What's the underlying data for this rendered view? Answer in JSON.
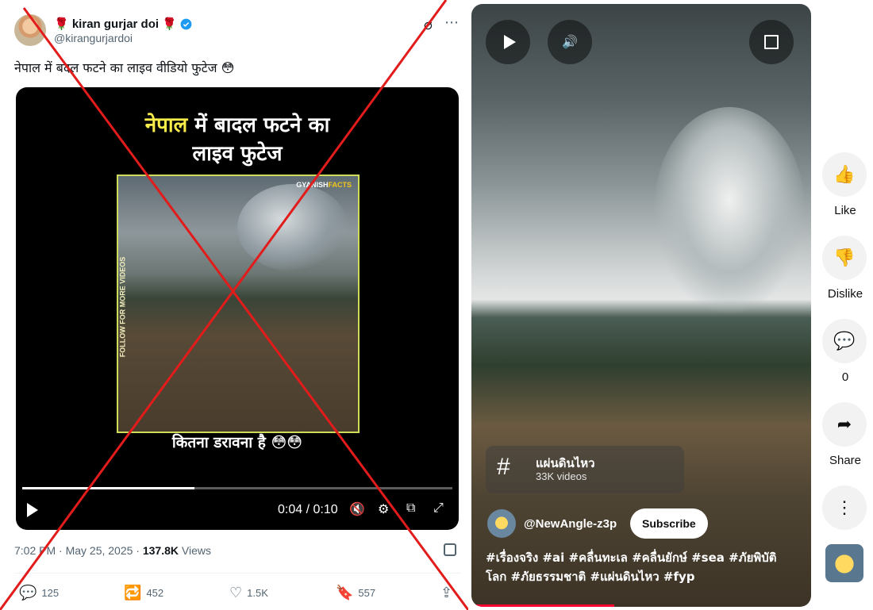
{
  "tweet": {
    "display_name": "🌹 kiran gurjar doi 🌹",
    "handle": "@kirangurjardoi",
    "text": "नेपाल में बदल फटने का लाइव वीडियो फुटेज 😳",
    "video": {
      "title_highlight": "नेपाल",
      "title_rest_line1": " में बादल फटने का",
      "title_line2": "लाइव फुटेज",
      "watermark_prefix": "GYANISH",
      "watermark_suffix": "FACTS",
      "side_text": "FOLLOW FOR MORE VIDEOS",
      "caption": "कितना डरावना है 😳😳",
      "time": "0:04 / 0:10",
      "progress": 0.4
    },
    "timestamp": "7:02 PM · May 25, 2025 · ",
    "views_count": "137.8K",
    "views_label": " Views",
    "actions": {
      "replies": "125",
      "reposts": "452",
      "likes": "1.5K",
      "bookmarks": "557"
    }
  },
  "short": {
    "tag_name": "แผ่นดินไหว",
    "tag_count": "33K videos",
    "channel": "@NewAngle-z3p",
    "subscribe_label": "Subscribe",
    "hashtags": "#เรื่องจริง #ai #คลื่นทะเล #คลื่นยักษ์ #sea #ภัยพิบัติโลก #ภัยธรรมชาติ #แผ่นดินไหว #fyp",
    "progress": 0.42
  },
  "sidebar": {
    "like_label": "Like",
    "dislike_label": "Dislike",
    "comments_count": "0",
    "share_label": "Share"
  }
}
